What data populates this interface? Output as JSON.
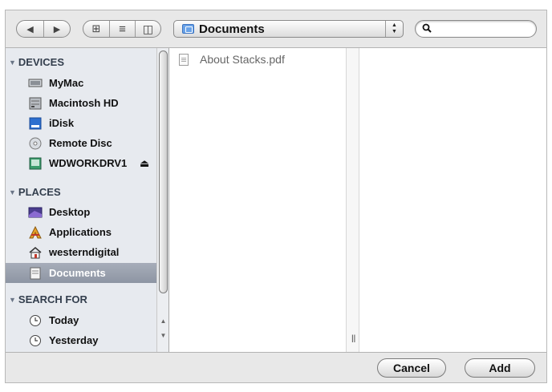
{
  "toolbar": {
    "back_label": "◀",
    "forward_label": "▶",
    "view_icon": "⊞",
    "view_list": "≡",
    "view_columns": "◫",
    "location": "Documents",
    "search": {
      "value": "",
      "placeholder": ""
    }
  },
  "sidebar": {
    "sections": [
      {
        "label": "DEVICES"
      },
      {
        "label": "PLACES"
      },
      {
        "label": "SEARCH FOR"
      }
    ],
    "devices": [
      {
        "label": "MyMac",
        "icon": "display-icon"
      },
      {
        "label": "Macintosh HD",
        "icon": "hard-drive-icon"
      },
      {
        "label": "iDisk",
        "icon": "idisk-icon"
      },
      {
        "label": "Remote Disc",
        "icon": "disc-icon"
      },
      {
        "label": "WDWORKDRV1",
        "icon": "external-drive-icon",
        "eject": "⏏"
      }
    ],
    "places": [
      {
        "label": "Desktop",
        "icon": "desktop-icon"
      },
      {
        "label": "Applications",
        "icon": "applications-icon"
      },
      {
        "label": "westerndigital",
        "icon": "home-icon"
      },
      {
        "label": "Documents",
        "icon": "documents-folder-icon",
        "selected": true
      }
    ],
    "search_for": [
      {
        "label": "Today",
        "icon": "clock-icon"
      },
      {
        "label": "Yesterday",
        "icon": "clock-icon"
      }
    ]
  },
  "browser": {
    "files": [
      {
        "name": "About Stacks.pdf",
        "icon": "pdf-document-icon"
      }
    ],
    "column_grip": "||"
  },
  "footer": {
    "cancel_label": "Cancel",
    "add_label": "Add"
  },
  "colors": {
    "sidebar_bg": "#e7eaef",
    "selection": "#8d95a3",
    "dialog_bg": "#e8e8e8"
  }
}
